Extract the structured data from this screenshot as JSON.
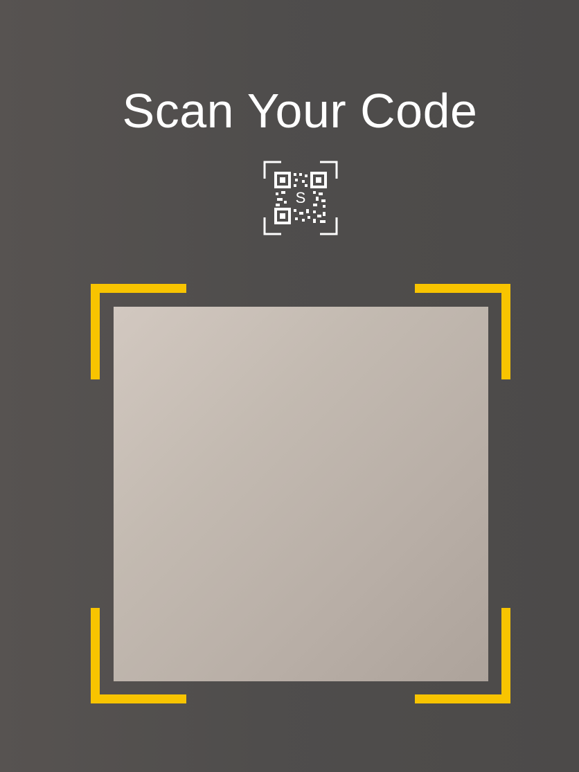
{
  "screen": {
    "title": "Scan Your Code"
  },
  "icons": {
    "header_icon": "qr-code-scan-icon",
    "header_icon_letter": "S"
  },
  "scanner": {
    "frame_color": "#f8c400",
    "preview": "camera-preview"
  },
  "colors": {
    "background": "#504d4c",
    "title_text": "#ffffff",
    "accent": "#f8c400"
  }
}
